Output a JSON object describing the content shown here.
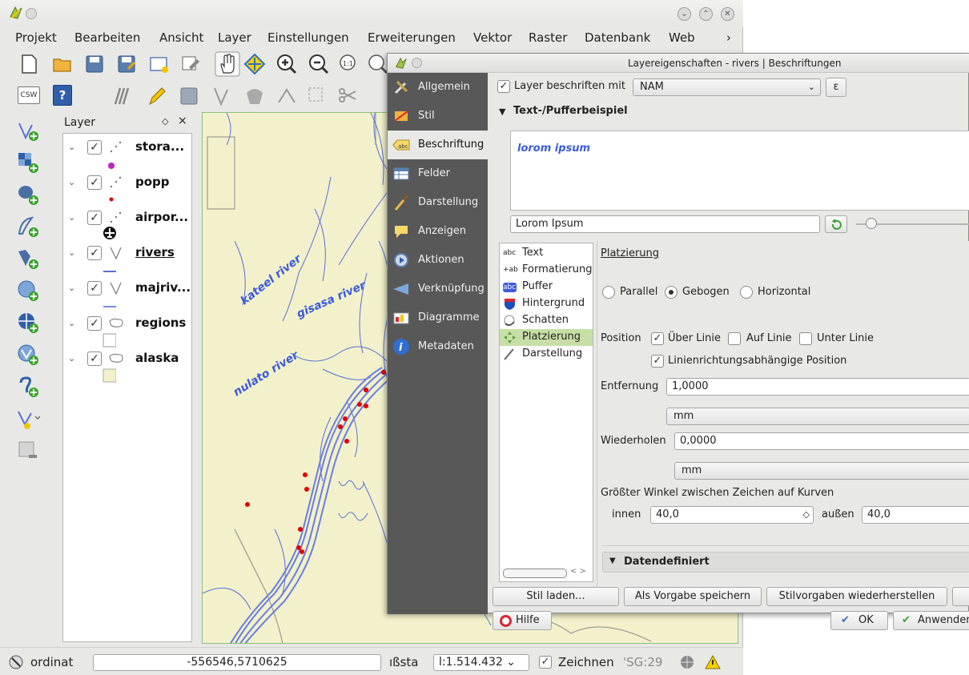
{
  "main_window": {
    "menu": [
      "Projekt",
      "Bearbeiten",
      "Ansicht",
      "Layer",
      "Einstellungen",
      "Erweiterungen",
      "Vektor",
      "Raster",
      "Datenbank",
      "Web"
    ],
    "menu_more": "›",
    "win_buttons": [
      "⌄",
      "⌃",
      "✕"
    ]
  },
  "toolbar": {
    "csw_label": "CSW",
    "help_label": "?"
  },
  "layer_panel": {
    "title": "Layer",
    "float_icon": "◇",
    "close_icon": "×",
    "layers": [
      {
        "name": "stora...",
        "geom": "point",
        "legend_color": "#c020c0",
        "checked": true,
        "expander": "⌄",
        "check_mark": "✓"
      },
      {
        "name": "popp",
        "geom": "point",
        "legend_color": "#e00000",
        "checked": true,
        "expander": "⌄",
        "check_mark": "✓"
      },
      {
        "name": "airpor...",
        "geom": "point",
        "legend_color": "#111111",
        "checked": true,
        "expander": "⌄",
        "check_mark": "✓"
      },
      {
        "name": "rivers",
        "geom": "line",
        "legend_color": "#5a6fd8",
        "checked": true,
        "expander": "⌄",
        "check_mark": "✓"
      },
      {
        "name": "majriv...",
        "geom": "line",
        "legend_color": "#7a8ce8",
        "checked": true,
        "expander": "⌄",
        "check_mark": "✓"
      },
      {
        "name": "regions",
        "geom": "polygon",
        "legend_color": "#ffffff",
        "checked": true,
        "expander": "⌄",
        "check_mark": "✓"
      },
      {
        "name": "alaska",
        "geom": "polygon",
        "legend_color": "#f2f1cb",
        "checked": true,
        "expander": "⌄",
        "check_mark": "✓"
      }
    ]
  },
  "map": {
    "labels": [
      "kateel river",
      "gisasa river",
      "nulato river"
    ],
    "land_color": "#f2f1cb",
    "river_color": "#5a6fd8",
    "point_color": "#e00000"
  },
  "statusbar": {
    "coord_label": "ordinat",
    "coord_value": "-556546,5710625",
    "scale_label": "ıßsta",
    "scale_value": "l:1.514.432 ⌄",
    "render_check": "✓",
    "render_label": "Zeichnen",
    "crs": "'SG:29"
  },
  "dialog": {
    "title": "Layereigenschaften - rivers | Beschriftungen",
    "sidebar": [
      {
        "label": "Allgemein",
        "icon": "tools-icon"
      },
      {
        "label": "Stil",
        "icon": "style-icon"
      },
      {
        "label": "Beschriftung",
        "icon": "labels-icon",
        "active": true
      },
      {
        "label": "Felder",
        "icon": "fields-icon"
      },
      {
        "label": "Darstellung",
        "icon": "rendering-icon"
      },
      {
        "label": "Anzeigen",
        "icon": "display-icon"
      },
      {
        "label": "Aktionen",
        "icon": "actions-icon"
      },
      {
        "label": "Verknüpfung",
        "icon": "joins-icon"
      },
      {
        "label": "Diagramme",
        "icon": "diagrams-icon"
      },
      {
        "label": "Metadaten",
        "icon": "metadata-icon"
      }
    ],
    "label_with": "Layer beschriften mit",
    "label_with_check": "✓",
    "label_field": "NAM",
    "expr_button": "ε",
    "sample_section": "Text-/Pufferbeispiel",
    "preview_text": "lorom ipsum",
    "sample_input": "Lorom Ipsum",
    "sub_tabs": [
      {
        "label": "Text",
        "icon": "abc"
      },
      {
        "label": "Formatierung",
        "icon": "+ab"
      },
      {
        "label": "Puffer",
        "icon": "abc"
      },
      {
        "label": "Hintergrund",
        "icon": "bg"
      },
      {
        "label": "Schatten",
        "icon": "shadow"
      },
      {
        "label": "Platzierung",
        "icon": "place",
        "active": true
      },
      {
        "label": "Darstellung",
        "icon": "brush"
      }
    ],
    "placement": {
      "heading": "Platzierung",
      "modes": [
        "Parallel",
        "Gebogen",
        "Horizontal"
      ],
      "selected_mode": "Gebogen",
      "position_label": "Position",
      "position_opts": [
        "Über Linie",
        "Auf Linie",
        "Unter Linie"
      ],
      "check_mark": "✓",
      "orientation_label": "Linienrichtungsabhängige Position",
      "distance_label": "Entfernung",
      "distance_value": "1,0000",
      "distance_unit": "mm",
      "repeat_label": "Wiederholen",
      "repeat_value": "0,0000",
      "repeat_unit": "mm",
      "max_angle_label": "Größter Winkel zwischen Zeichen auf Kurven",
      "inner_label": "innen",
      "inner_value": "40,0",
      "outer_label": "außen",
      "outer_value": "40,0",
      "data_defined": "Datendefiniert"
    },
    "buttons": {
      "load_style": "Stil laden...",
      "save_default": "Als Vorgabe speichern",
      "restore_default": "Stilvorgaben wiederherstellen",
      "help": "Hilfe",
      "ok": "OK",
      "apply": "Anwenden"
    }
  }
}
